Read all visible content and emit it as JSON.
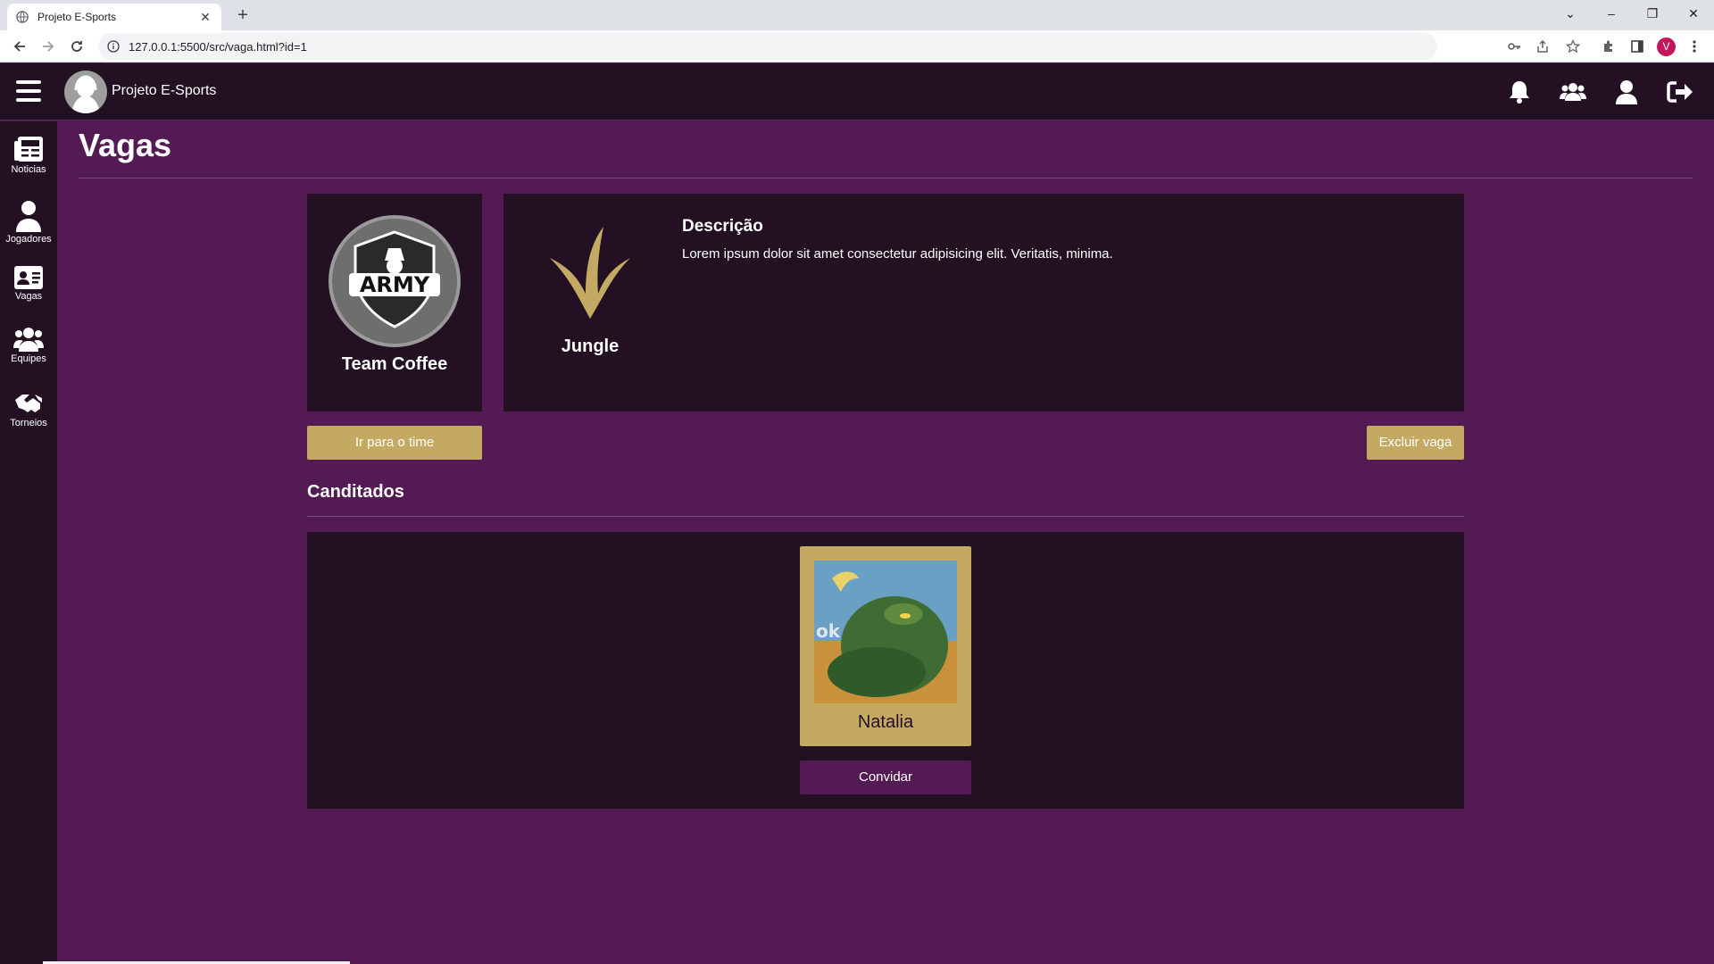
{
  "browser": {
    "tab_title": "Projeto E-Sports",
    "url": "127.0.0.1:5500/src/vaga.html?id=1",
    "profile_initial": "V"
  },
  "header": {
    "brand": "Projeto E-Sports"
  },
  "sidebar": {
    "items": [
      {
        "label": "Noticias",
        "icon": "newspaper-icon"
      },
      {
        "label": "Jogadores",
        "icon": "user-icon"
      },
      {
        "label": "Vagas",
        "icon": "id-card-icon"
      },
      {
        "label": "Equipes",
        "icon": "users-icon"
      },
      {
        "label": "Torneios",
        "icon": "handshake-icon"
      }
    ]
  },
  "page": {
    "title": "Vagas"
  },
  "vacancy": {
    "team_name": "Team Coffee",
    "team_logo_text": "ARMY",
    "role": "Jungle",
    "description_title": "Descrição",
    "description": "Lorem ipsum dolor sit amet consectetur adipisicing elit. Veritatis, minima.",
    "go_to_team_label": "Ir para o time",
    "delete_label": "Excluir vaga"
  },
  "candidates": {
    "title": "Canditados",
    "items": [
      {
        "name": "Natalia",
        "invite_label": "Convidar",
        "image_overlay": "ok"
      }
    ]
  },
  "colors": {
    "background": "#531a53",
    "panel": "#231123",
    "gold": "#c4a962"
  }
}
